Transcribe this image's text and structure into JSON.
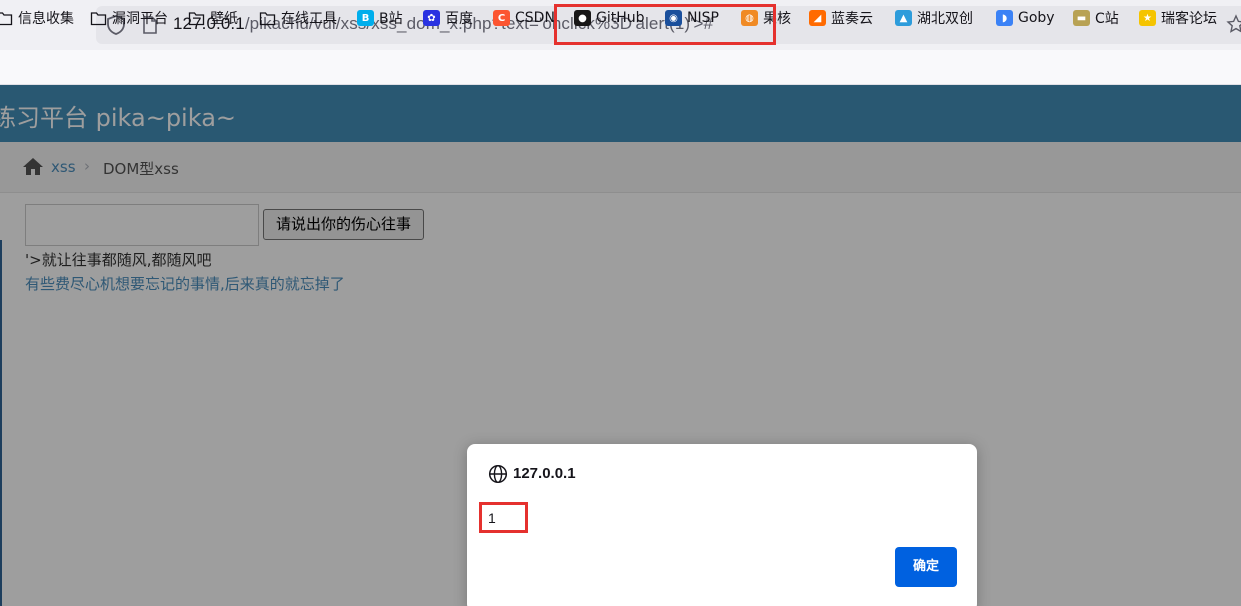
{
  "browser": {
    "url_host": "127.0.0.1",
    "url_path": "/pikachu/vul/xss/xss_dom_x.php?text='onclick%3D'alert(1)'>#",
    "bookmarks": [
      {
        "label": "信息收集",
        "icon": "folder-icon"
      },
      {
        "label": "漏洞平台",
        "icon": "folder-icon"
      },
      {
        "label": "壁纸",
        "icon": "folder-icon"
      },
      {
        "label": "在线工具",
        "icon": "folder-icon"
      },
      {
        "label": "B站",
        "icon": "bilibili-icon",
        "color": "#00aeec"
      },
      {
        "label": "百度",
        "icon": "baidu-paw-icon",
        "color": "#2932e1"
      },
      {
        "label": "CSDN",
        "icon": "csdn-icon",
        "color": "#fc5531"
      },
      {
        "label": "GitHub",
        "icon": "github-icon",
        "color": "#181717"
      },
      {
        "label": "NISP",
        "icon": "nisp-icon",
        "color": "#1a4f9c"
      },
      {
        "label": "果核",
        "icon": "guohe-icon",
        "color": "#f08a24"
      },
      {
        "label": "蓝奏云",
        "icon": "lanzou-icon",
        "color": "#ff6a00"
      },
      {
        "label": "湖北双创",
        "icon": "hubei-icon",
        "color": "#2d9cdb"
      },
      {
        "label": "Goby",
        "icon": "goby-icon",
        "color": "#3b82f6"
      },
      {
        "label": "C站",
        "icon": "c-station-icon",
        "color": "#b8a254"
      },
      {
        "label": "瑞客论坛",
        "icon": "trophy-icon",
        "color": "#f5c400"
      }
    ]
  },
  "page": {
    "site_title": "练习平台 pika~pika~",
    "breadcrumb": {
      "link": "xss",
      "current": "DOM型xss"
    },
    "input_value": "",
    "submit_label": "请说出你的伤心往事",
    "output_text": "'>就让往事都随风,都随风吧",
    "hint_text": "有些费尽心机想要忘记的事情,后来真的就忘掉了"
  },
  "dialog": {
    "origin": "127.0.0.1",
    "message": "1",
    "ok_label": "确定"
  },
  "colors": {
    "header_blue": "#438eb9",
    "highlight_red": "#e5312e",
    "dialog_button": "#0061e0",
    "link_blue": "#4c8fbd"
  }
}
